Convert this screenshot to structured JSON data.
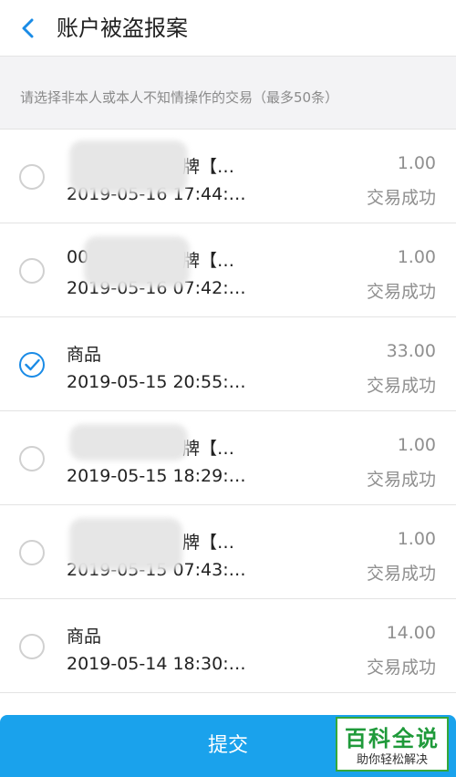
{
  "header": {
    "title": "账户被盗报案",
    "back_icon": "chevron-left-icon"
  },
  "hint": "请选择非本人或本人不知情操作的交易（最多50条）",
  "transactions": [
    {
      "name": "牌【…",
      "time": "2019-05-16 17:44:…",
      "amount": "1.00",
      "status": "交易成功",
      "checked": false
    },
    {
      "name": "00",
      "name_suffix": "牌【…",
      "time": "2019-05-16 07:42:…",
      "amount": "1.00",
      "status": "交易成功",
      "checked": false
    },
    {
      "name": "商品",
      "time": "2019-05-15 20:55:…",
      "amount": "33.00",
      "status": "交易成功",
      "checked": true
    },
    {
      "name": "牌【…",
      "time": "2019-05-15 18:29:…",
      "amount": "1.00",
      "status": "交易成功",
      "checked": false
    },
    {
      "name": "牌【…",
      "time": "2019-05-15 07:43:…",
      "amount": "1.00",
      "status": "交易成功",
      "checked": false
    },
    {
      "name": "商品",
      "time": "2019-05-14 18:30:…",
      "amount": "14.00",
      "status": "交易成功",
      "checked": false
    }
  ],
  "partial_row_text": "…",
  "submit_label": "提交",
  "watermark": {
    "top": "百科全说",
    "bottom": "助你轻松解决"
  },
  "colors": {
    "accent": "#1aa2ec",
    "check": "#1a8be6",
    "watermark_green": "#1f9a3a"
  }
}
